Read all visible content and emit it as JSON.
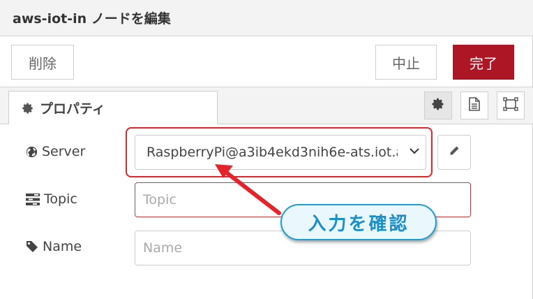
{
  "header": {
    "title": "aws-iot-in ノードを編集"
  },
  "toolbar": {
    "delete_label": "削除",
    "cancel_label": "中止",
    "done_label": "完了"
  },
  "tabs": [
    {
      "label": "プロパティ",
      "icon": "gear-icon"
    }
  ],
  "tab_icons": [
    "gear-icon",
    "document-icon",
    "frame-icon"
  ],
  "form": {
    "server": {
      "label": "Server",
      "icon": "globe-icon",
      "value": "RaspberryPi@a3ib4ekd3nih6e-ats.iot.a"
    },
    "topic": {
      "label": "Topic",
      "icon": "tasks-icon",
      "placeholder": "Topic",
      "value": ""
    },
    "name": {
      "label": "Name",
      "icon": "tag-icon",
      "placeholder": "Name",
      "value": ""
    }
  },
  "annotation": {
    "text": "入力を確認"
  },
  "colors": {
    "done_bg": "#ad1625",
    "highlight": "#e3242b",
    "callout_border": "#1e9ed6",
    "callout_text": "#1b8fca",
    "invalid_border": "#c63a3a"
  }
}
